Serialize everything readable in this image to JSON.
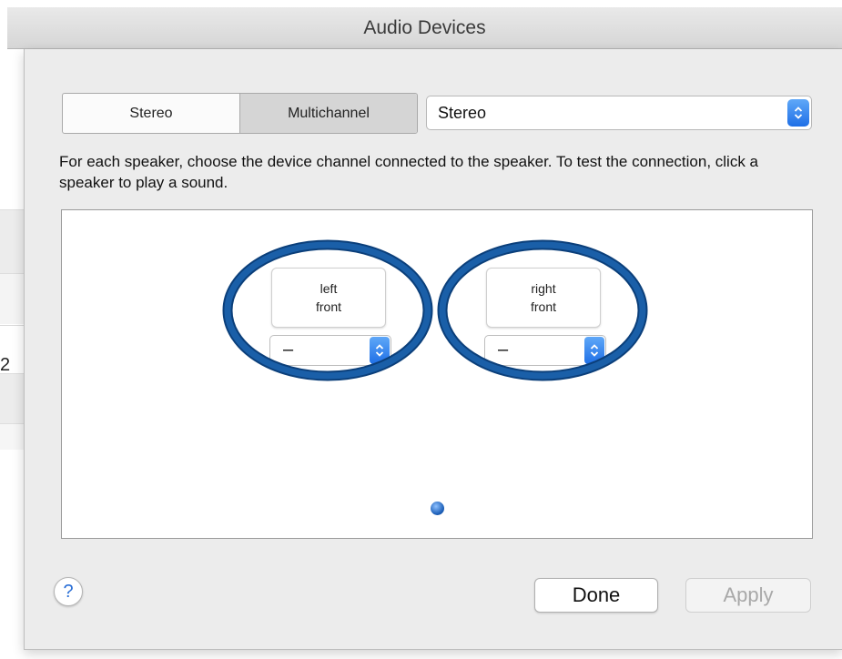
{
  "window": {
    "title": "Audio Devices"
  },
  "background": {
    "fragment_text": "2"
  },
  "mode_tabs": [
    {
      "label": "Stereo",
      "selected": false
    },
    {
      "label": "Multichannel",
      "selected": true
    }
  ],
  "configuration": {
    "selected": "Stereo"
  },
  "instructions": "For each speaker, choose the device channel connected to the speaker. To test the connection, click a speaker to play a sound.",
  "speakers": [
    {
      "label_line1": "left",
      "label_line2": "front",
      "channel": "–"
    },
    {
      "label_line1": "right",
      "label_line2": "front",
      "channel": "–"
    }
  ],
  "footer": {
    "help_label": "?",
    "done_label": "Done",
    "apply_label": "Apply"
  },
  "colors": {
    "accent_blue": "#1f6fe6",
    "annotation_blue": "#1a5fa8",
    "sheet_bg": "#ececec"
  },
  "icons": {
    "popup_arrow": "chevron-updown-icon",
    "help": "question-mark-icon",
    "listener": "listener-dot-icon"
  }
}
